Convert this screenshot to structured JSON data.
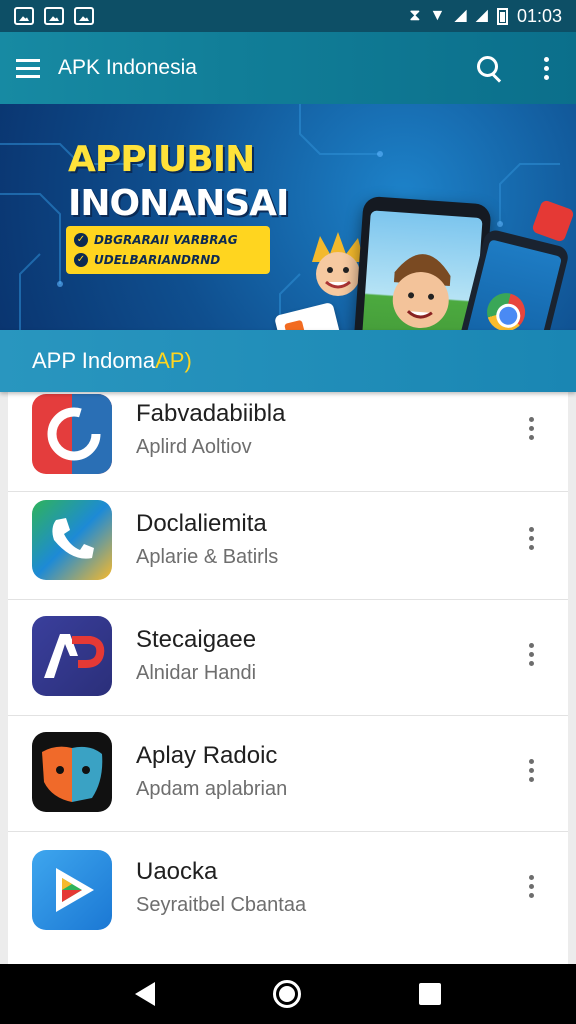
{
  "status_bar": {
    "time": "01:03",
    "notification_icons": [
      "image-icon",
      "image-icon",
      "image-icon"
    ],
    "system_icons": [
      "vibrate-icon",
      "wifi-icon",
      "signal-icon",
      "battery-icon"
    ]
  },
  "app_bar": {
    "title": "APK Indonesia",
    "icons": [
      "menu-icon",
      "search-icon",
      "overflow-menu-icon"
    ]
  },
  "banner": {
    "title_line1": "APPIUBIN",
    "title_line2": "INONANSAI",
    "pill1": "DBGRARAII VARBRAG",
    "pill2": "UDELBARIANDRND"
  },
  "section": {
    "title_main": "APP Indoma",
    "title_accent": " AP)"
  },
  "apps": [
    {
      "title": "Fabvadabiibla",
      "subtitle": "Aplird Aoltiov",
      "icon": "red-circle-app-icon"
    },
    {
      "title": "Doclaliemita",
      "subtitle": "Aplarie & Batirls",
      "icon": "phone-app-icon"
    },
    {
      "title": "Stecaigaee",
      "subtitle": "Alnidar Handi",
      "icon": "ap-logo-app-icon"
    },
    {
      "title": "Aplay Radoic",
      "subtitle": "Apdam aplabrian",
      "icon": "face-app-icon"
    },
    {
      "title": "Uaocka",
      "subtitle": "Seyraitbel Cbantaa",
      "icon": "play-app-icon"
    }
  ],
  "colors": {
    "app_bar": "#117e98",
    "section_header": "#2293c0",
    "banner_accent": "#ffe23a",
    "nav_bar": "#000000"
  }
}
